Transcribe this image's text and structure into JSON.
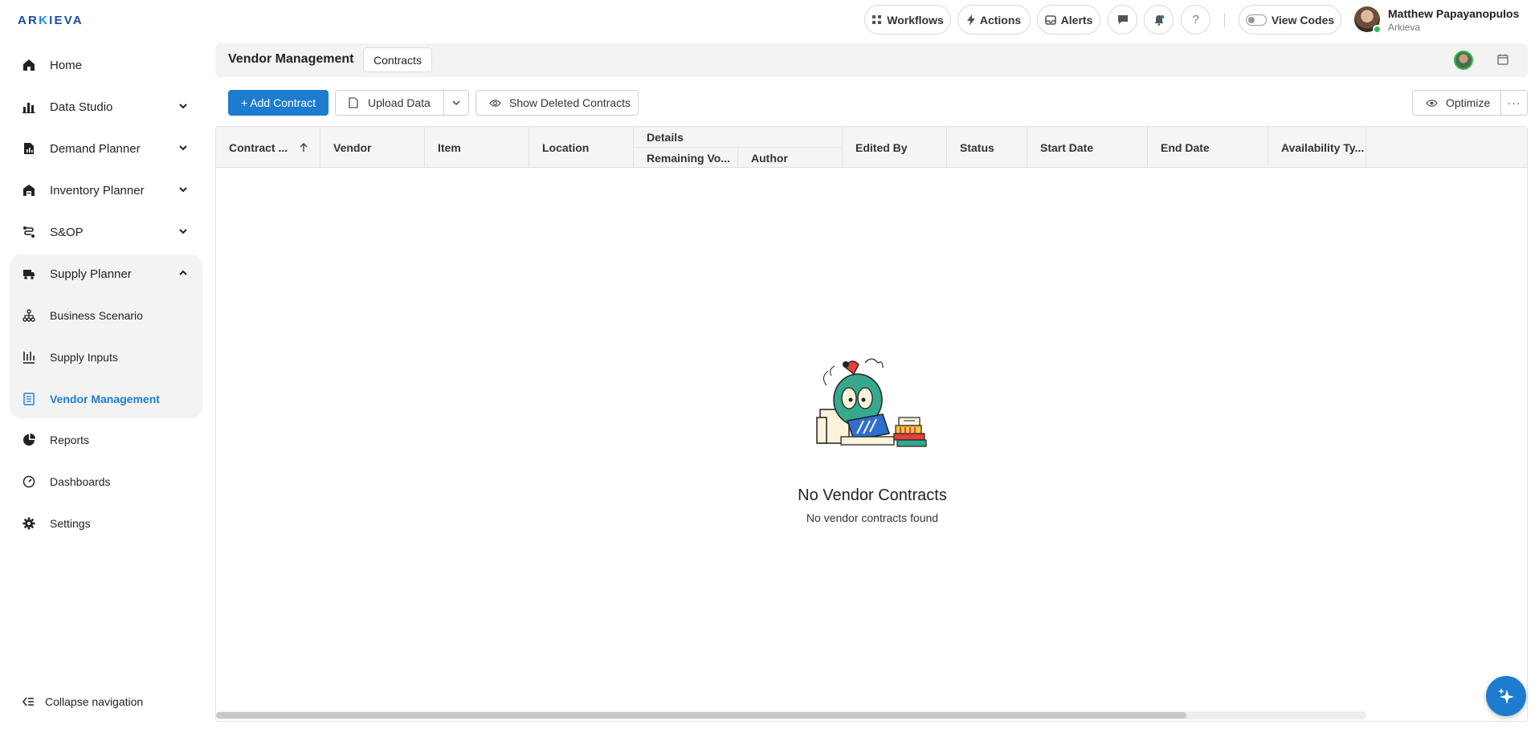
{
  "brand": {
    "logo_prefix": "AR",
    "logo_k": "K",
    "logo_suffix": "IEVA"
  },
  "topbar": {
    "workflows": "Workflows",
    "actions": "Actions",
    "alerts": "Alerts",
    "view_codes": "View Codes",
    "user_name": "Matthew Papayanopulos",
    "user_org": "Arkieva"
  },
  "sidebar": {
    "items": [
      {
        "label": "Home",
        "icon": "home-icon"
      },
      {
        "label": "Data Studio",
        "icon": "bar-chart-icon"
      },
      {
        "label": "Demand Planner",
        "icon": "document-chart-icon"
      },
      {
        "label": "Inventory Planner",
        "icon": "warehouse-icon"
      },
      {
        "label": "S&OP",
        "icon": "flow-icon"
      },
      {
        "label": "Supply Planner",
        "icon": "truck-icon"
      },
      {
        "label": "Business Scenario",
        "icon": "hierarchy-icon"
      },
      {
        "label": "Supply Inputs",
        "icon": "inputs-icon"
      },
      {
        "label": "Vendor Management",
        "icon": "list-icon"
      },
      {
        "label": "Reports",
        "icon": "pie-chart-icon"
      },
      {
        "label": "Dashboards",
        "icon": "gauge-icon"
      },
      {
        "label": "Settings",
        "icon": "gear-icon"
      }
    ],
    "collapse_label": "Collapse navigation"
  },
  "header": {
    "title": "Vendor Management",
    "tab": "Contracts"
  },
  "toolbar": {
    "add_contract": "+ Add Contract",
    "upload_data": "Upload Data",
    "show_deleted": "Show Deleted Contracts",
    "optimize": "Optimize"
  },
  "table": {
    "columns": [
      "Contract ...",
      "Vendor",
      "Item",
      "Location",
      "Edited By",
      "Status",
      "Start Date",
      "End Date",
      "Availability Ty..."
    ],
    "group_header": "Details",
    "group_columns": [
      "Remaining Vo...",
      "Author"
    ],
    "empty_title": "No Vendor Contracts",
    "empty_subtitle": "No vendor contracts found"
  },
  "colors": {
    "accent": "#1d7cd0",
    "online": "#27c24c"
  }
}
